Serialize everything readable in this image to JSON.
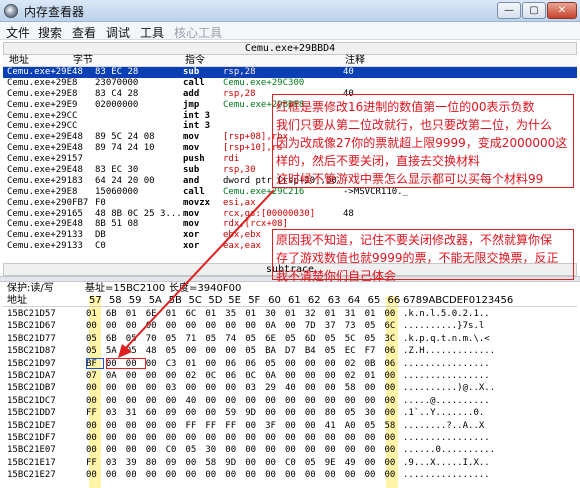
{
  "window": {
    "title": "内存查看器",
    "min": "—",
    "max": "▢",
    "close": "✕"
  },
  "menu": [
    {
      "label": "文件",
      "enabled": true
    },
    {
      "label": "搜索",
      "enabled": true
    },
    {
      "label": "查看",
      "enabled": true
    },
    {
      "label": "调试",
      "enabled": true
    },
    {
      "label": "工具",
      "enabled": true
    },
    {
      "label": "核心工具",
      "enabled": false
    }
  ],
  "disassembler": {
    "header": "Cemu.exe+29BBD4",
    "columns": {
      "address": "地址",
      "bytes": "字节",
      "opcode": "指令",
      "comment": "注释"
    },
    "rows": [
      {
        "addr": "Cemu.exe+29E48",
        "bytes": "83 EC 28",
        "mn": "sub",
        "op": "rsp,28",
        "cm": "40",
        "selected": true
      },
      {
        "addr": "Cemu.exe+29E8",
        "bytes": "23070000",
        "mn": "call",
        "op": "Cemu.exe+29C300",
        "cm": ""
      },
      {
        "addr": "Cemu.exe+29E8",
        "bytes": "83 C4 28",
        "mn": "add",
        "op": "rsp,28",
        "cm": "40"
      },
      {
        "addr": "Cemu.exe+29E9",
        "bytes": "02000000",
        "mn": "jmp",
        "op": "Cemu.exe+29BBF8",
        "cm": ""
      },
      {
        "addr": "Cemu.exe+29CC",
        "bytes": "",
        "mn": "int 3",
        "op": "",
        "cm": ""
      },
      {
        "addr": "Cemu.exe+29CC",
        "bytes": "",
        "mn": "int 3",
        "op": "",
        "cm": ""
      },
      {
        "addr": "Cemu.exe+29E48",
        "bytes": "89 5C 24 08",
        "mn": "mov",
        "op": "[rsp+08],rbx",
        "cm": ""
      },
      {
        "addr": "Cemu.exe+29E48",
        "bytes": "89 74 24 10",
        "mn": "mov",
        "op": "[rsp+10],rs",
        "cm": ""
      },
      {
        "addr": "Cemu.exe+29157",
        "bytes": "",
        "mn": "push",
        "op": "rdi",
        "cm": ""
      },
      {
        "addr": "Cemu.exe+29E48",
        "bytes": "83 EC 30",
        "mn": "sub",
        "op": "rsp,30",
        "cm": ""
      },
      {
        "addr": "Cemu.exe+29183",
        "bytes": "64 24 20 00",
        "mn": "and",
        "op": "dword ptr [rsp+20],00",
        "cm": ""
      },
      {
        "addr": "Cemu.exe+29E8",
        "bytes": "15060000",
        "mn": "call",
        "op": "Cemu.exe+29C216",
        "cm": "->MSVCR110._"
      },
      {
        "addr": "Cemu.exe+290FB7",
        "bytes": "F0",
        "mn": "movzx",
        "op": "esi,ax",
        "cm": ""
      },
      {
        "addr": "Cemu.exe+29165",
        "bytes": "48 8B 0C 25 3...",
        "mn": "mov",
        "op": "rcx,gs:[00000030]",
        "cm": "48"
      },
      {
        "addr": "Cemu.exe+29E48",
        "bytes": "8B 51 08",
        "mn": "mov",
        "op": "rdx,[rcx+08]",
        "cm": ""
      },
      {
        "addr": "Cemu.exe+29133",
        "bytes": "DB",
        "mn": "xor",
        "op": "ebx,ebx",
        "cm": ""
      },
      {
        "addr": "Cemu.exe+29133",
        "bytes": "C0",
        "mn": "xor",
        "op": "eax,eax",
        "cm": ""
      }
    ],
    "footer": "subtrace"
  },
  "hex": {
    "protect": "保护:读/写",
    "base": "基址=15BC2100",
    "size": "长度=3940F00",
    "addr_label": "地址",
    "columns": [
      "57",
      "58",
      "59",
      "5A",
      "5B",
      "5C",
      "5D",
      "5E",
      "5F",
      "60",
      "61",
      "62",
      "63",
      "64",
      "65",
      "66"
    ],
    "ascii_header": "6789ABCDEF0123456",
    "rows": [
      {
        "addr": "15BC21D57",
        "bytes": [
          "01",
          "6B",
          "01",
          "6E",
          "01",
          "6C",
          "01",
          "35",
          "01",
          "30",
          "01",
          "32",
          "01",
          "31",
          "01",
          "00"
        ],
        "ascii": ".k.n.l.5.0.2.1.."
      },
      {
        "addr": "15BC21D67",
        "bytes": [
          "00",
          "00",
          "00",
          "00",
          "00",
          "00",
          "00",
          "00",
          "00",
          "0A",
          "00",
          "7D",
          "37",
          "73",
          "05",
          "6C"
        ],
        "ascii": "..........}7s.l"
      },
      {
        "addr": "15BC21D77",
        "bytes": [
          "05",
          "6B",
          "05",
          "70",
          "05",
          "71",
          "05",
          "74",
          "05",
          "6E",
          "05",
          "6D",
          "05",
          "5C",
          "05",
          "3C"
        ],
        "ascii": ".k.p.q.t.n.m.\\.<"
      },
      {
        "addr": "15BC21D87",
        "bytes": [
          "05",
          "5A",
          "05",
          "48",
          "05",
          "00",
          "00",
          "00",
          "05",
          "BA",
          "D7",
          "B4",
          "05",
          "EC",
          "F7",
          "06"
        ],
        "ascii": ".Z.H............."
      },
      {
        "addr": "15BC21D97",
        "bytes": [
          "BF",
          "00",
          "00",
          "00",
          "C3",
          "01",
          "00",
          "06",
          "06",
          "05",
          "00",
          "00",
          "00",
          "02",
          "0B",
          "06"
        ],
        "ascii": "................"
      },
      {
        "addr": "15BC21DA7",
        "bytes": [
          "07",
          "0A",
          "00",
          "00",
          "00",
          "02",
          "0C",
          "06",
          "0C",
          "0A",
          "00",
          "00",
          "00",
          "02",
          "01",
          "00"
        ],
        "ascii": "................"
      },
      {
        "addr": "15BC21DB7",
        "bytes": [
          "00",
          "00",
          "00",
          "00",
          "03",
          "00",
          "00",
          "00",
          "03",
          "29",
          "40",
          "00",
          "00",
          "58",
          "00",
          "00"
        ],
        "ascii": "..........)@..X.."
      },
      {
        "addr": "15BC21DC7",
        "bytes": [
          "00",
          "00",
          "00",
          "00",
          "00",
          "40",
          "00",
          "00",
          "00",
          "00",
          "00",
          "00",
          "00",
          "00",
          "00",
          "00"
        ],
        "ascii": ".....@.........."
      },
      {
        "addr": "15BC21DD7",
        "bytes": [
          "FF",
          "03",
          "31",
          "60",
          "09",
          "00",
          "00",
          "59",
          "9D",
          "00",
          "00",
          "00",
          "80",
          "05",
          "30",
          "00"
        ],
        "ascii": ".1`..Y.......0."
      },
      {
        "addr": "15BC21DE7",
        "bytes": [
          "00",
          "00",
          "00",
          "00",
          "00",
          "FF",
          "FF",
          "FF",
          "00",
          "3F",
          "00",
          "00",
          "41",
          "A0",
          "05",
          "58"
        ],
        "ascii": "........?..A..X"
      },
      {
        "addr": "15BC21DF7",
        "bytes": [
          "00",
          "00",
          "00",
          "00",
          "00",
          "00",
          "00",
          "00",
          "00",
          "00",
          "00",
          "00",
          "00",
          "00",
          "00",
          "00"
        ],
        "ascii": "................"
      },
      {
        "addr": "15BC21E07",
        "bytes": [
          "00",
          "00",
          "00",
          "00",
          "C0",
          "05",
          "30",
          "00",
          "00",
          "00",
          "00",
          "00",
          "00",
          "00",
          "00",
          "00"
        ],
        "ascii": "......0.........."
      },
      {
        "addr": "15BC21E17",
        "bytes": [
          "FF",
          "03",
          "39",
          "80",
          "09",
          "00",
          "58",
          "9D",
          "00",
          "00",
          "C0",
          "05",
          "9E",
          "49",
          "00",
          "00"
        ],
        "ascii": ".9...X.....I.X.."
      },
      {
        "addr": "15BC21E27",
        "bytes": [
          "00",
          "00",
          "00",
          "00",
          "00",
          "00",
          "00",
          "00",
          "00",
          "00",
          "00",
          "00",
          "00",
          "00",
          "00",
          "00"
        ],
        "ascii": "................"
      }
    ]
  },
  "annotations": {
    "note1": [
      "红框是票修改16进制的数值第一位的00表示负数",
      "我们只要从第二位改就行，也只要改第二位，为什么",
      "因为改成像27你的票就超上限9999，变成2000000这",
      "样的，然后不要关闭，直接去交换材料",
      "这时候不管游戏中票怎么显示都可以买每个材料99"
    ],
    "note2": [
      "原因我不知道，记住不要关闭修改器，不然就算你保",
      "存了游戏数值也就9999的票，不能无限交换票，反正",
      "我不清楚你们自己体会"
    ]
  },
  "colors": {
    "selection": "#0a3fb5",
    "annotation": "#e02020",
    "highlight_col": "#fff4a8",
    "title_bar": "#bcd2ec"
  }
}
